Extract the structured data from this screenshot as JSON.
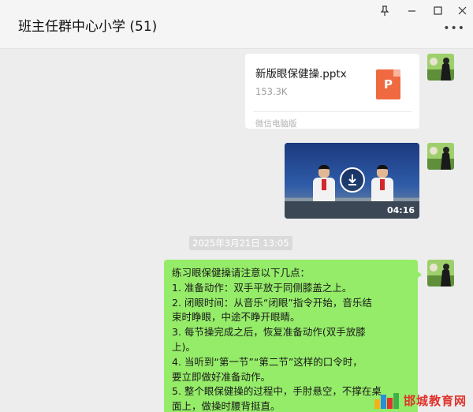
{
  "window": {
    "title": "班主任群中心小学 (51)",
    "controls": {
      "pin": "⊥",
      "minimize": "—",
      "maximize": "☐",
      "close": "✕"
    },
    "more": "•••"
  },
  "messages": {
    "file": {
      "name": "新版眼保健操.pptx",
      "size": "153.3K",
      "source": "微信电脑版",
      "icon_letter": "P",
      "icon_color": "#ef6a40"
    },
    "video": {
      "duration": "04:16",
      "icon": "download-icon"
    },
    "timestamp": "2025年3月21日 13:05",
    "text_lines": [
      "练习眼保健操请注意以下几点：",
      "1. 准备动作：双手平放于同侧膝盖之上。",
      "2. 闭眼时间：从音乐“闭眼”指令开始，音乐结",
      "束时睁眼，中途不睁开眼睛。",
      "3. 每节操完成之后，恢复准备动作(双手放膝",
      "上)。",
      "4. 当听到“第一节”“第二节”这样的口令时，",
      "要立即做好准备动作。",
      "5. 整个眼保健操的过程中，手肘悬空，不撑在桌",
      "面上，做操时腰背挺直。"
    ],
    "bubble_color": "#95ec69"
  },
  "watermark": {
    "text": "邯城教育网"
  }
}
